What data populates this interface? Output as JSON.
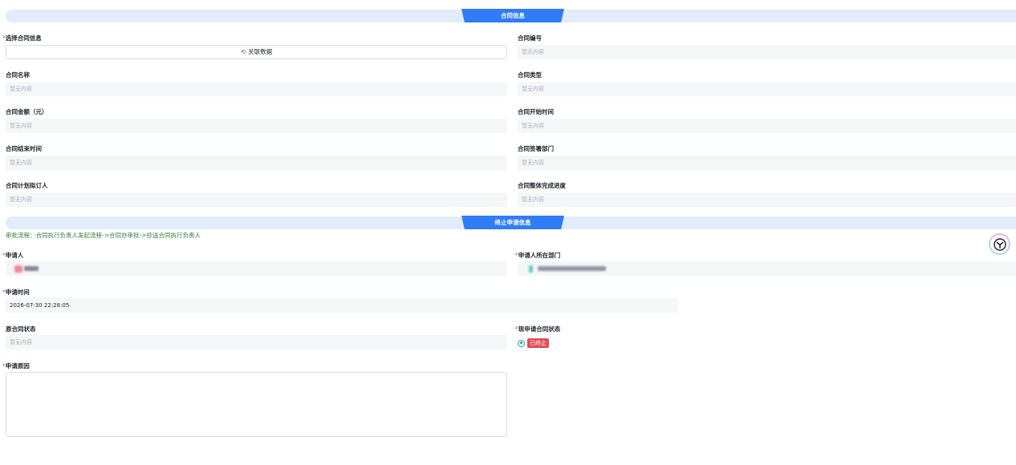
{
  "section1": {
    "title": "合同信息"
  },
  "section2": {
    "title": "终止申请信息"
  },
  "empty_text": "暂无内容",
  "contract": {
    "select_label": "选择合同信息",
    "link_button": "关联数据",
    "fields": [
      {
        "label": "合同编号",
        "value": "暂无内容"
      },
      {
        "label": "合同名称",
        "value": "暂无内容"
      },
      {
        "label": "合同类型",
        "value": "暂无内容"
      },
      {
        "label": "合同金额（元）",
        "value": "暂无内容"
      },
      {
        "label": "合同开始时间",
        "value": "暂无内容"
      },
      {
        "label": "合同结束时间",
        "value": "暂无内容"
      },
      {
        "label": "合同签署部门",
        "value": "暂无内容"
      },
      {
        "label": "合同计划拟订人",
        "value": "暂无内容"
      },
      {
        "label": "合同整体完成进度",
        "value": "暂无内容"
      }
    ]
  },
  "termination": {
    "flow_text": "审批流程：合同执行负责人发起流程->合同办审批->抄送合同执行负责人",
    "applicant_label": "申请人",
    "applicant_dept_label": "申请人所在部门",
    "apply_time_label": "申请时间",
    "apply_time_value": "2026-07-30 22:28:05",
    "orig_status_label": "原合同状态",
    "orig_status_value": "暂无内容",
    "new_status_label": "现申请合同状态",
    "new_status_option": "已终止",
    "reason_label": "申请原因"
  },
  "colors": {
    "accent": "#2f7cf6",
    "danger": "#e34d59",
    "flow": "#2e7d32",
    "radio": "#17a589"
  }
}
